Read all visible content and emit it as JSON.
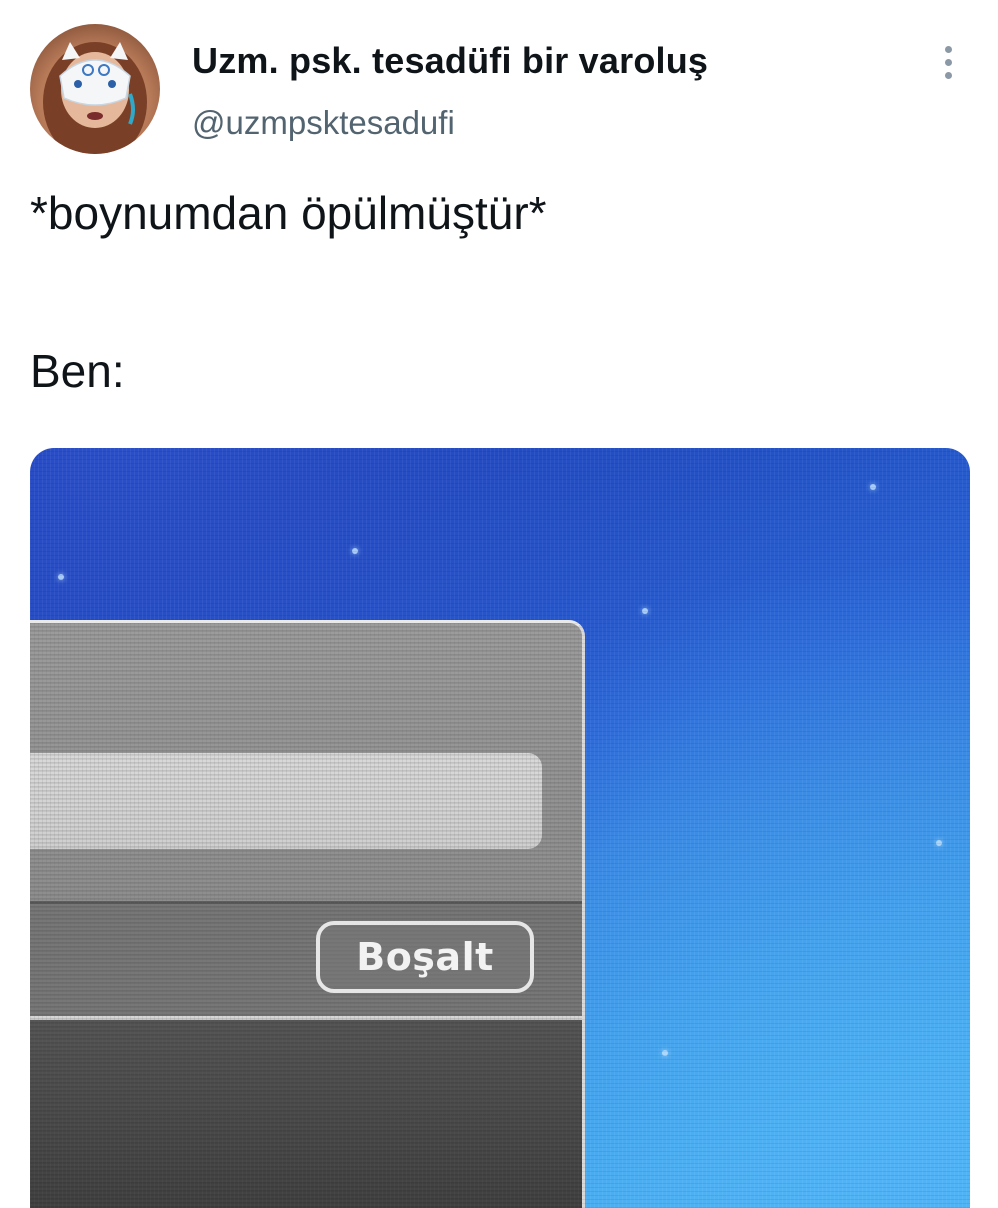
{
  "tweet": {
    "author": {
      "display_name": "Uzm. psk. tesadüfi bir varoluş",
      "handle": "@uzmpsktesadufi",
      "avatar_icon": "profile-avatar"
    },
    "menu_icon": "more-vertical-icon",
    "text_lines": [
      "*boynumdan öpülmüştür*",
      "Ben:"
    ]
  },
  "media": {
    "button_label": "Boşalt"
  },
  "colors": {
    "text_primary": "#0f1419",
    "text_secondary": "#536471",
    "wallpaper_blue": "#2a66d8"
  }
}
